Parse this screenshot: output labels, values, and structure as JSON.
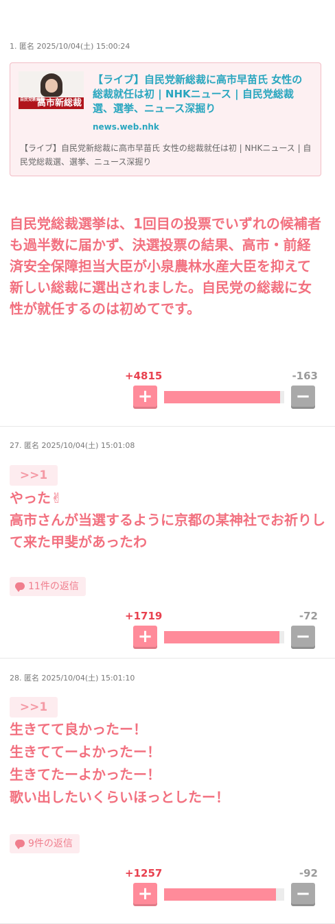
{
  "posts": [
    {
      "meta": "1. 匿名 2025/10/04(土) 15:00:24",
      "link_card": {
        "title": "【ライブ】自民党新総裁に高市早苗氏 女性の総裁就任は初 | NHKニュース | 自民党総裁選、選挙、ニュース深掘り",
        "domain": "news.web.nhk",
        "description": "【ライブ】自民党新総裁に高市早苗氏 女性の総裁就任は初 | NHKニュース | 自民党総裁選、選挙、ニュース深掘り",
        "thumbnail_caption": "高市新総裁"
      },
      "body": "自民党総裁選挙は、1回目の投票でいずれの候補者も過半数に届かず、決選投票の結果、高市・前経済安全保障担当大臣が小泉農林水産大臣を抑えて新しい総裁に選出されました。自民党の総裁に女性が就任するのは初めてです。",
      "plus": "+4815",
      "minus": "-163",
      "plus_ratio": 0.967
    },
    {
      "meta": "27. 匿名 2025/10/04(土) 15:01:08",
      "anchor": ">>1",
      "body": "やった✌\n高市さんが当選するように京都の某神社でお祈りして来た甲斐があったわ",
      "replies": "11件の返信",
      "plus": "+1719",
      "minus": "-72",
      "plus_ratio": 0.96
    },
    {
      "meta": "28. 匿名 2025/10/04(土) 15:01:10",
      "anchor": ">>1",
      "body": "生きてて良かったー！\n生きててーよかったー！\n生きてたーよかったー！\n歌い出したいくらいほっとしたー！",
      "replies": "9件の返信",
      "plus": "+1257",
      "minus": "-92",
      "plus_ratio": 0.932
    }
  ],
  "colors": {
    "accent_pink": "#ff8b9a",
    "body_text": "#f2707f",
    "link": "#29a6bf",
    "plus_count": "#e8414f"
  },
  "icons": [
    "plus-icon",
    "minus-icon",
    "speech-bubble-icon"
  ]
}
